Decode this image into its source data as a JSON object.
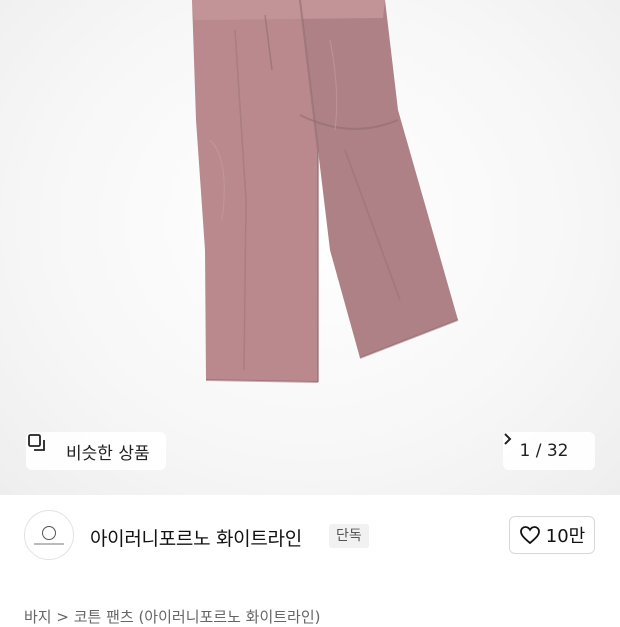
{
  "product_image": {
    "alt": "pink wide trousers",
    "background": "#f4f4f4",
    "garment_color": "#b58a8e"
  },
  "similar_products": {
    "label": "비슷한 상품",
    "icon": "similar-squares-icon"
  },
  "image_counter": {
    "text": "1 / 32",
    "icon": "chevron-right-icon"
  },
  "shop": {
    "name": "아이러니포르노 화이트라인",
    "badge": "단독",
    "likes": "10만",
    "like_icon": "heart-icon"
  },
  "breadcrumb": {
    "text": "바지 > 코튼 팬츠 (아이러니포르노 화이트라인)"
  }
}
